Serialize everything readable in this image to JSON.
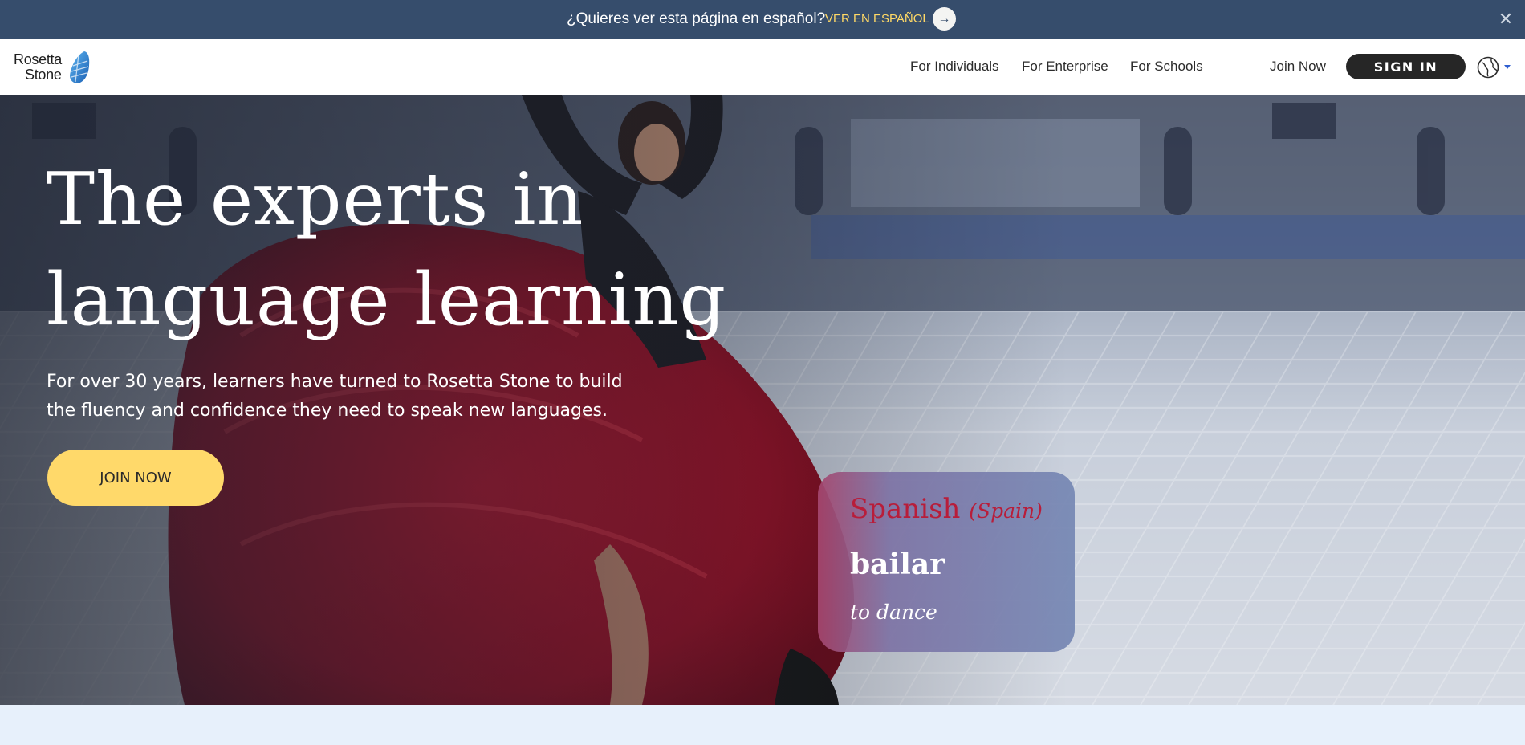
{
  "language_banner": {
    "prompt": "¿Quieres ver esta página en español?",
    "switch_label": "VER EN ESPAÑOL",
    "arrow_icon": "arrow-right-icon",
    "close_icon": "close-icon",
    "background": "#364d6c",
    "link_color": "#ffd966"
  },
  "header": {
    "logo": {
      "line1": "Rosetta",
      "line2": "Stone"
    },
    "nav": [
      {
        "label": "For Individuals"
      },
      {
        "label": "For Enterprise"
      },
      {
        "label": "For Schools"
      }
    ],
    "join_label": "Join Now",
    "sign_in_label": "SIGN IN",
    "globe_icon": "globe-icon"
  },
  "hero": {
    "title_line1": "The experts in",
    "title_line2": "language learning",
    "subtitle": "For over 30 years, learners have turned to Rosetta Stone to build the fluency and confidence they need to speak new languages.",
    "cta_label": "JOIN NOW",
    "cta_color": "#ffd96a",
    "card": {
      "language": "Spanish",
      "region": "(Spain)",
      "word": "bailar",
      "translation": "to dance"
    }
  }
}
